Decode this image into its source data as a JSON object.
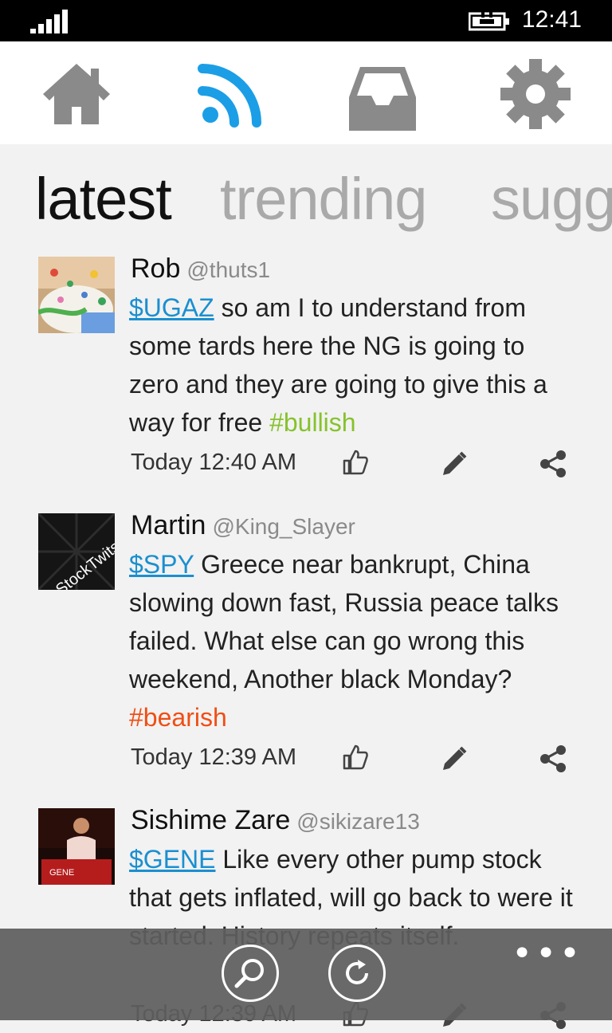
{
  "status": {
    "time": "12:41"
  },
  "nav": {
    "items": [
      {
        "name": "home",
        "icon": "home-icon"
      },
      {
        "name": "stream",
        "icon": "rss-icon",
        "active": true
      },
      {
        "name": "inbox",
        "icon": "inbox-icon"
      },
      {
        "name": "settings",
        "icon": "gear-icon"
      }
    ],
    "colors": {
      "active": "#1b9ee6",
      "inactive": "#8a8a8a"
    }
  },
  "pivot": {
    "tabs": [
      "latest",
      "trending",
      "sugg"
    ]
  },
  "posts": [
    {
      "name": "Rob",
      "handle": "@thuts1",
      "ticker": "$UGAZ",
      "text": " so am I to understand from some tards here the NG is going to zero and they are going to give this a way for free ",
      "tag": "#bullish",
      "time": "Today 12:40 AM",
      "avatar": "cupcake-avatar"
    },
    {
      "name": "Martin",
      "handle": "@King_Slayer",
      "ticker": "$SPY",
      "text": " Greece near bankrupt, China slowing down fast, Russia peace talks failed.  What else can go wrong this weekend, Another black Monday? ",
      "tag": "#bearish",
      "time": "Today 12:39 AM",
      "avatar": "stocktwits-avatar",
      "avatar_text": "StockTwits"
    },
    {
      "name": "Sishime Zare",
      "handle": "@sikizare13",
      "ticker": "$GENE",
      "text": " Like every other pump stock that gets inflated, will go back to were it started. History repeats itself.",
      "tag": "",
      "time": "Today 12:39 AM",
      "avatar": "speaker-avatar"
    }
  ],
  "appbar": {
    "buttons": [
      {
        "name": "search",
        "icon": "search-icon"
      },
      {
        "name": "refresh",
        "icon": "refresh-icon"
      }
    ],
    "more": "•••"
  },
  "colors": {
    "ticker": "#1b8fd0",
    "bullish": "#86c22c",
    "bearish": "#f04e14"
  }
}
